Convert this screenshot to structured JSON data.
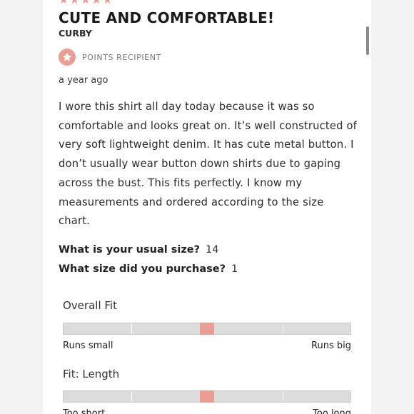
{
  "review": {
    "stars": "★★★★★",
    "title": "CUTE AND COMFORTABLE!",
    "author": "CURBY",
    "badge_label": "POINTS RECIPIENT",
    "date": "a year ago",
    "body": "I wore this shirt all day today because it was so comfortable and looks great on. It’s well constructed of very soft lightweight denim. It has cute metal button. I don’t usually wear button down shirts due to gaping across the bust. This fits perfectly. I know my measurements and ordered according to the size chart.",
    "questions": [
      {
        "question": "What is your usual size?",
        "answer": "14"
      },
      {
        "question": "What size did you purchase?",
        "answer": "1"
      }
    ]
  },
  "fit": [
    {
      "title": "Overall Fit",
      "left_label": "Runs small",
      "right_label": "Runs big",
      "value": 0.5
    },
    {
      "title": "Fit: Length",
      "left_label": "Too short",
      "right_label": "Too long",
      "value": 0.5
    }
  ],
  "colors": {
    "accent": "#e99d94",
    "track": "#dcdcdc",
    "background": "#f3f3f3"
  },
  "icons": {
    "badge": "star-icon"
  }
}
